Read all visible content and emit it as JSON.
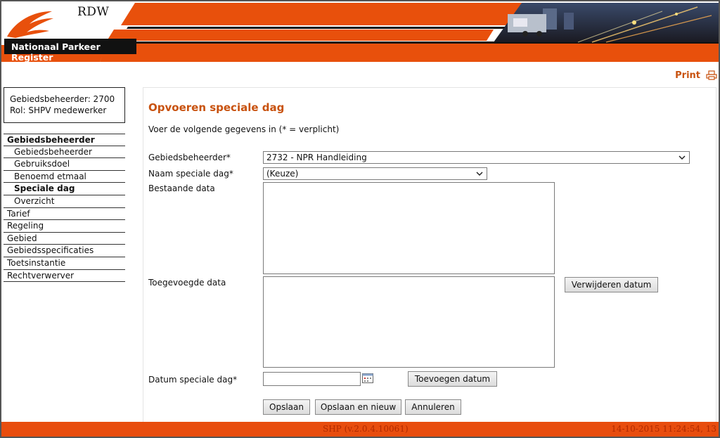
{
  "header": {
    "brand": "RDW",
    "app_title": "Nationaal Parkeer Register"
  },
  "print_label": "Print",
  "user": {
    "line1": "Gebiedsbeheerder: 2700",
    "line2": "Rol: SHPV medewerker"
  },
  "nav": {
    "items": [
      {
        "label": "Gebiedsbeheerder"
      },
      {
        "label": "Gebiedsbeheerder"
      },
      {
        "label": "Gebruiksdoel"
      },
      {
        "label": "Benoemd etmaal"
      },
      {
        "label": "Speciale dag"
      },
      {
        "label": "Overzicht"
      },
      {
        "label": "Tarief"
      },
      {
        "label": "Regeling"
      },
      {
        "label": "Gebied"
      },
      {
        "label": "Gebiedsspecificaties"
      },
      {
        "label": "Toetsinstantie"
      },
      {
        "label": "Rechtverwerver"
      }
    ]
  },
  "form": {
    "title": "Opvoeren speciale dag",
    "intro": "Voer de volgende gegevens in (* = verplicht)",
    "gebiedsbeheerder_label": "Gebiedsbeheerder*",
    "gebiedsbeheerder_value": "2732 - NPR Handleiding",
    "naam_label": "Naam speciale dag*",
    "naam_value": "(Keuze)",
    "bestaande_label": "Bestaande data",
    "toegevoegde_label": "Toegevoegde data",
    "verwijderen_button": "Verwijderen datum",
    "datum_label": "Datum speciale dag*",
    "datum_value": "",
    "toevoegen_button": "Toevoegen datum",
    "opslaan_button": "Opslaan",
    "opslaan_nieuw_button": "Opslaan en nieuw",
    "annuleren_button": "Annuleren"
  },
  "footer": {
    "version": "SHP (v.2.0.4.10061)",
    "timestamp": "14-10-2015 11:24:54, 13"
  },
  "colors": {
    "accent": "#c8520f",
    "footer_bg": "#e84d0e",
    "header_orange": "#e8500c"
  }
}
